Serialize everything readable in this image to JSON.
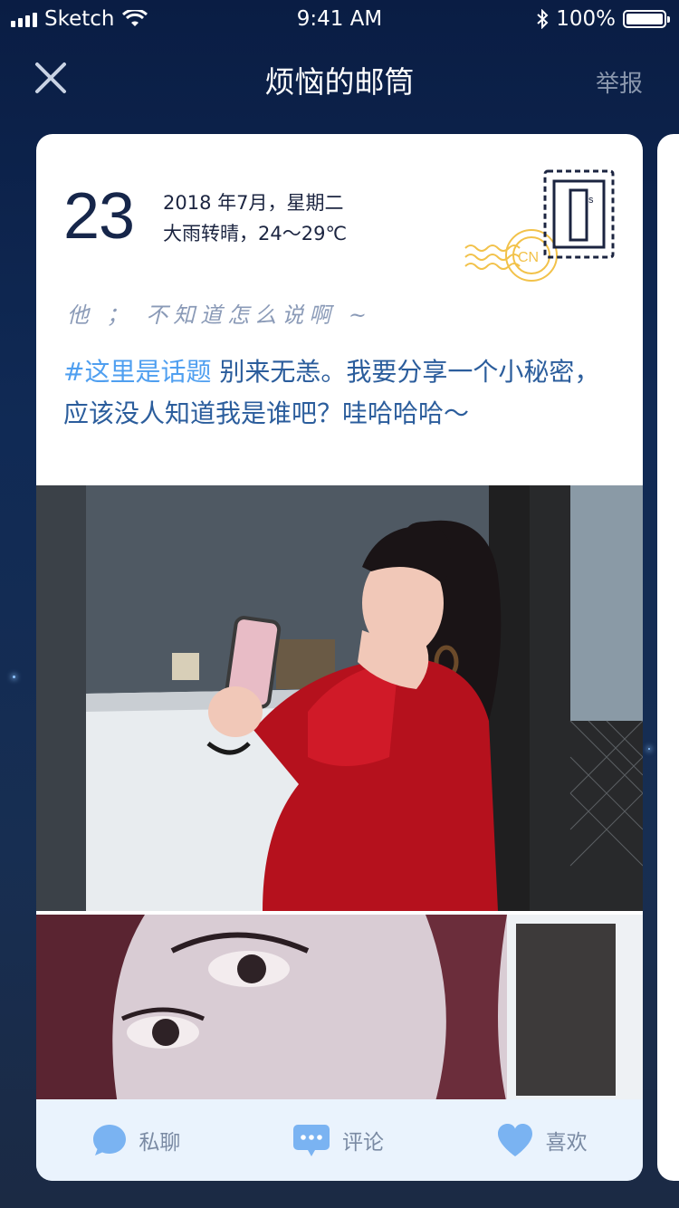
{
  "status_bar": {
    "carrier": "Sketch",
    "time": "9:41 AM",
    "battery": "100%",
    "battery_level": 1.0
  },
  "nav": {
    "title": "烦恼的邮筒",
    "report_label": "举报",
    "close_icon": "close-icon"
  },
  "card": {
    "day": "23",
    "date_line": "2018 年7月，星期二",
    "weather_line": "大雨转晴，24～29℃",
    "handwritten_line": "他 ； 不知道怎么说啊 ~",
    "hashtag": "#这里是话题",
    "body_text": " 别来无恙。我要分享一个小秘密，应该没人知道我是谁吧？哇哈哈哈～",
    "stamp_letter": "s",
    "stamp_postmark": "CN"
  },
  "actions": [
    {
      "label": "私聊",
      "icon": "chat-bubble-icon"
    },
    {
      "label": "评论",
      "icon": "comment-icon"
    },
    {
      "label": "喜欢",
      "icon": "heart-icon"
    }
  ],
  "colors": {
    "accent": "#4f9ff0",
    "body_text": "#2b5d9c",
    "action_bar": "#eaf3fd",
    "background": "#0a1d44"
  }
}
